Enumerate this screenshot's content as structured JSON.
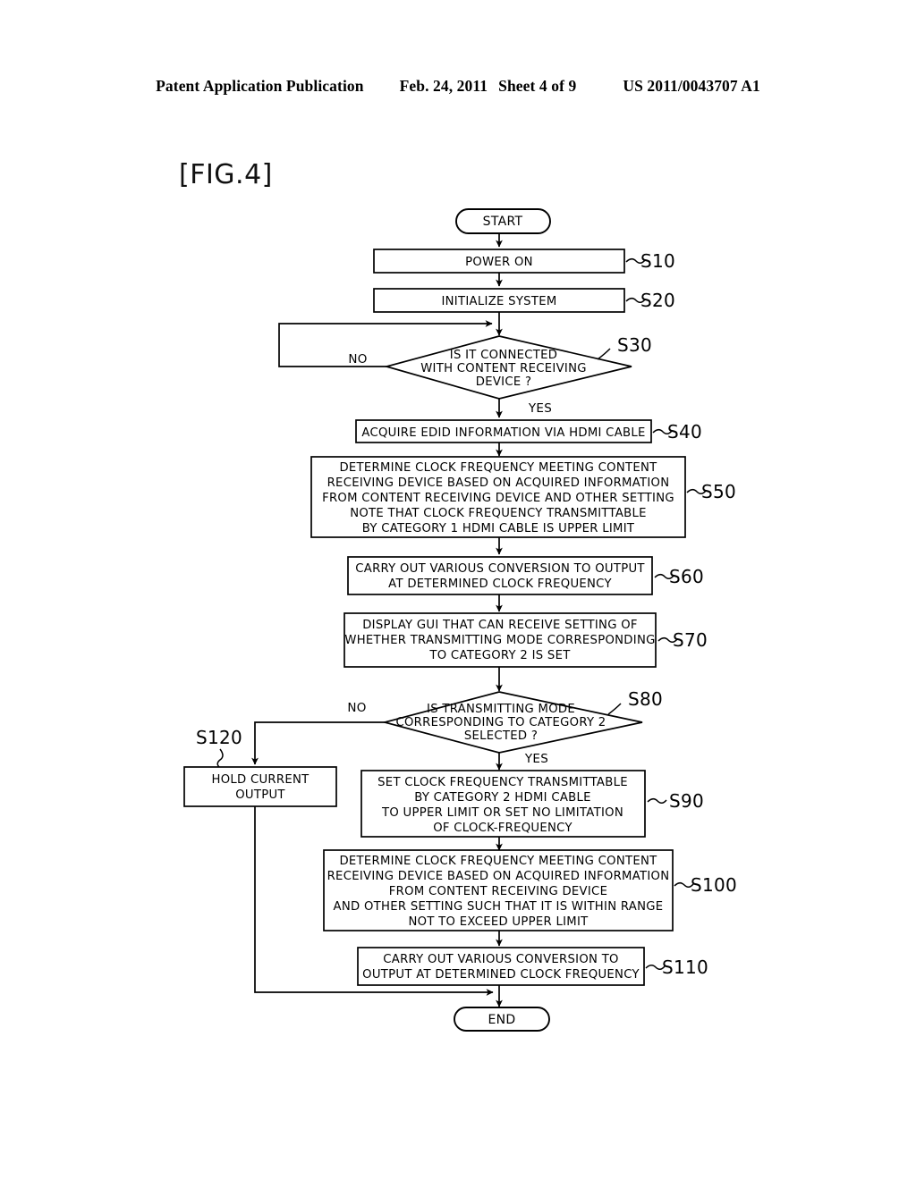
{
  "header": {
    "publication": "Patent Application Publication",
    "date": "Feb. 24, 2011",
    "sheet": "Sheet 4 of 9",
    "docnum": "US 2011/0043707 A1"
  },
  "figure": {
    "title": "[FIG.4]"
  },
  "chart_data": {
    "type": "diagram",
    "diagram_type": "flowchart",
    "title": "[FIG.4]",
    "nodes": [
      {
        "id": "start",
        "shape": "terminator",
        "text": "START",
        "ref": ""
      },
      {
        "id": "s10",
        "shape": "process",
        "text": "POWER ON",
        "ref": "S10"
      },
      {
        "id": "s20",
        "shape": "process",
        "text": "INITIALIZE SYSTEM",
        "ref": "S20"
      },
      {
        "id": "s30",
        "shape": "decision",
        "text": "IS IT CONNECTED WITH CONTENT RECEIVING DEVICE ?",
        "ref": "S30"
      },
      {
        "id": "s40",
        "shape": "process",
        "text": "ACQUIRE EDID INFORMATION VIA HDMI CABLE",
        "ref": "S40"
      },
      {
        "id": "s50",
        "shape": "process",
        "text": "DETERMINE CLOCK FREQUENCY MEETING CONTENT RECEIVING DEVICE BASED ON ACQUIRED INFORMATION FROM CONTENT RECEIVING DEVICE AND OTHER SETTING NOTE THAT CLOCK FREQUENCY TRANSMITTABLE BY CATEGORY 1 HDMI CABLE IS UPPER LIMIT",
        "ref": "S50"
      },
      {
        "id": "s60",
        "shape": "process",
        "text": "CARRY OUT VARIOUS CONVERSION TO OUTPUT AT DETERMINED CLOCK FREQUENCY",
        "ref": "S60"
      },
      {
        "id": "s70",
        "shape": "process",
        "text": "DISPLAY GUI THAT CAN RECEIVE SETTING OF WHETHER TRANSMITTING MODE CORRESPONDING TO CATEGORY 2 IS SET",
        "ref": "S70"
      },
      {
        "id": "s80",
        "shape": "decision",
        "text": "IS TRANSMITTING MODE CORRESPONDING TO CATEGORY 2 SELECTED ?",
        "ref": "S80"
      },
      {
        "id": "s120",
        "shape": "process",
        "text": "HOLD CURRENT OUTPUT",
        "ref": "S120"
      },
      {
        "id": "s90",
        "shape": "process",
        "text": "SET CLOCK FREQUENCY TRANSMITTABLE BY CATEGORY 2 HDMI CABLE TO UPPER LIMIT OR SET NO LIMITATION OF CLOCK-FREQUENCY",
        "ref": "S90"
      },
      {
        "id": "s100",
        "shape": "process",
        "text": "DETERMINE CLOCK FREQUENCY MEETING CONTENT RECEIVING DEVICE BASED ON ACQUIRED INFORMATION FROM CONTENT RECEIVING DEVICE AND OTHER SETTING SUCH THAT IT IS WITHIN RANGE NOT TO EXCEED UPPER LIMIT",
        "ref": "S100"
      },
      {
        "id": "s110",
        "shape": "process",
        "text": "CARRY OUT VARIOUS CONVERSION TO OUTPUT AT DETERMINED CLOCK FREQUENCY",
        "ref": "S110"
      },
      {
        "id": "end",
        "shape": "terminator",
        "text": "END",
        "ref": ""
      }
    ],
    "edges": [
      {
        "from": "start",
        "to": "s10",
        "label": ""
      },
      {
        "from": "s10",
        "to": "s20",
        "label": ""
      },
      {
        "from": "s20",
        "to": "s30",
        "label": ""
      },
      {
        "from": "s30",
        "to": "s30",
        "label": "NO"
      },
      {
        "from": "s30",
        "to": "s40",
        "label": "YES"
      },
      {
        "from": "s40",
        "to": "s50",
        "label": ""
      },
      {
        "from": "s50",
        "to": "s60",
        "label": ""
      },
      {
        "from": "s60",
        "to": "s70",
        "label": ""
      },
      {
        "from": "s70",
        "to": "s80",
        "label": ""
      },
      {
        "from": "s80",
        "to": "s120",
        "label": "NO"
      },
      {
        "from": "s80",
        "to": "s90",
        "label": "YES"
      },
      {
        "from": "s90",
        "to": "s100",
        "label": ""
      },
      {
        "from": "s100",
        "to": "s110",
        "label": ""
      },
      {
        "from": "s110",
        "to": "end",
        "label": ""
      },
      {
        "from": "s120",
        "to": "end",
        "label": ""
      }
    ]
  },
  "nodes": {
    "start": {
      "line1": "START"
    },
    "s10": {
      "line1": "POWER ON",
      "ref": "S10"
    },
    "s20": {
      "line1": "INITIALIZE SYSTEM",
      "ref": "S20"
    },
    "s30": {
      "line1": "IS IT CONNECTED",
      "line2": "WITH CONTENT RECEIVING",
      "line3": "DEVICE ?",
      "ref": "S30",
      "no": "NO",
      "yes": "YES"
    },
    "s40": {
      "line1": "ACQUIRE EDID INFORMATION VIA HDMI CABLE",
      "ref": "S40"
    },
    "s50": {
      "line1": "DETERMINE CLOCK FREQUENCY MEETING CONTENT",
      "line2": "RECEIVING DEVICE BASED ON ACQUIRED INFORMATION",
      "line3": "FROM CONTENT RECEIVING DEVICE AND OTHER SETTING",
      "line4": "NOTE THAT CLOCK FREQUENCY TRANSMITTABLE",
      "line5": "BY CATEGORY 1 HDMI CABLE IS UPPER LIMIT",
      "ref": "S50"
    },
    "s60": {
      "line1": "CARRY OUT VARIOUS CONVERSION TO OUTPUT",
      "line2": "AT DETERMINED CLOCK FREQUENCY",
      "ref": "S60"
    },
    "s70": {
      "line1": "DISPLAY GUI THAT CAN RECEIVE SETTING OF",
      "line2": "WHETHER TRANSMITTING MODE CORRESPONDING",
      "line3": "TO CATEGORY 2 IS SET",
      "ref": "S70"
    },
    "s80": {
      "line1": "IS TRANSMITTING MODE",
      "line2": "CORRESPONDING TO CATEGORY 2",
      "line3": "SELECTED ?",
      "ref": "S80",
      "no": "NO",
      "yes": "YES"
    },
    "s120": {
      "line1": "HOLD CURRENT",
      "line2": "OUTPUT",
      "ref": "S120"
    },
    "s90": {
      "line1": "SET CLOCK FREQUENCY TRANSMITTABLE",
      "line2": "BY CATEGORY 2 HDMI CABLE",
      "line3": "TO UPPER LIMIT OR SET NO LIMITATION",
      "line4": "OF CLOCK-FREQUENCY",
      "ref": "S90"
    },
    "s100": {
      "line1": "DETERMINE CLOCK FREQUENCY MEETING CONTENT",
      "line2": "RECEIVING DEVICE BASED ON ACQUIRED INFORMATION",
      "line3": "FROM CONTENT RECEIVING DEVICE",
      "line4": "AND OTHER SETTING SUCH THAT IT IS WITHIN RANGE",
      "line5": "NOT TO EXCEED UPPER LIMIT",
      "ref": "S100"
    },
    "s110": {
      "line1": "CARRY OUT VARIOUS CONVERSION TO",
      "line2": "OUTPUT AT DETERMINED CLOCK FREQUENCY",
      "ref": "S110"
    },
    "end": {
      "line1": "END"
    }
  },
  "colors": {
    "ink": "#000000",
    "paper": "#ffffff"
  }
}
